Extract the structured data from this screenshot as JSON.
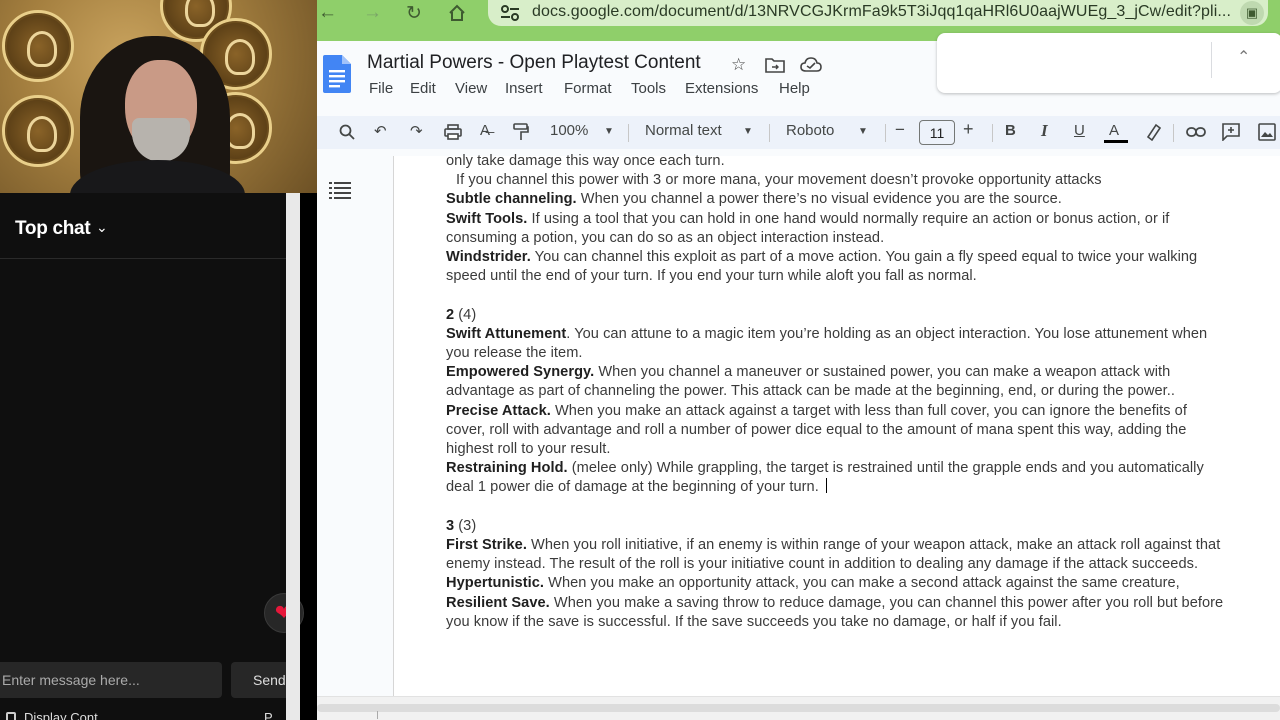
{
  "webcam": {
    "label": "streamer webcam"
  },
  "chat": {
    "header_title": "Top chat",
    "input_placeholder": "Enter message here...",
    "send_label": "Send",
    "footer_left": "Display Cont",
    "footer_right": "P"
  },
  "browser": {
    "url": "docs.google.com/document/d/13NRVCGJKrmFa9k5T3iJqq1qaHRl6U0aajWUEg_3_jCw/edit?pli..."
  },
  "docs": {
    "title": "Martial Powers - Open Playtest Content",
    "menus": [
      "File",
      "Edit",
      "View",
      "Insert",
      "Format",
      "Tools",
      "Extensions",
      "Help"
    ],
    "toolbar": {
      "zoom": "100%",
      "style": "Normal text",
      "font": "Roboto",
      "font_size": "11",
      "minus": "−",
      "plus": "+",
      "bold": "B",
      "italic": "I",
      "underline": "U",
      "text_color": "A"
    },
    "content": {
      "l1": "only take damage this way once each turn.",
      "l2": "If you channel this power with 3 or more mana,  your movement doesn’t provoke opportunity attacks",
      "e1_name": "Subtle channeling.",
      "e1_text": " When you channel a power there’s no visual evidence you are the source.",
      "e2_name": "Swift Tools.",
      "e2_text": " If using a tool that you can hold in one hand would normally require an action or bonus action, or if consuming a potion, you can do so as an object interaction instead.",
      "e3_name": "Windstrider.",
      "e3_text": " You can channel this exploit as part of a move action. You gain a fly speed equal to twice your walking speed until the end of your turn. If you end your turn while aloft you fall as normal.",
      "h2_num": "2",
      "h2_count": " (4)",
      "e4_name": "Swift Attunement",
      "e4_text": ". You can attune to a magic item you’re holding as an object interaction. You lose attunement when you release the item.",
      "e5_name": "Empowered Synergy.",
      "e5_text": " When you channel a maneuver or sustained power, you can make a weapon attack with advantage as part of channeling the power. This attack can be made at the beginning, end, or during the power..",
      "e6_name": "Precise Attack.",
      "e6_text": " When you make an attack against a target with less than full cover, you can ignore the benefits of cover, roll with advantage and roll a number of power dice equal to the amount of mana spent this way, adding the highest roll to your result.",
      "e7_name": "Restraining Hold.",
      "e7_text": " (melee only) While grappling, the target is restrained until the grapple ends and you automatically deal 1 power die of damage at the beginning of your turn. ",
      "h3_num": "3",
      "h3_count": " (3)",
      "e8_name": "First Strike.",
      "e8_text": " When you roll initiative, if an enemy is within range of your weapon attack, make an attack roll against that enemy instead. The result of the roll is your initiative count in addition to dealing any damage if the attack succeeds.",
      "e9_name": "Hypertunistic.",
      "e9_text": " When you make an opportunity attack, you can make a second attack against the same creature,",
      "e10_name": "Resilient Save.",
      "e10_text": " When you make a saving throw to reduce damage, you can channel this power after you roll but before you know if the save is successful. If the save succeeds you take no damage, or half if you fail."
    }
  }
}
